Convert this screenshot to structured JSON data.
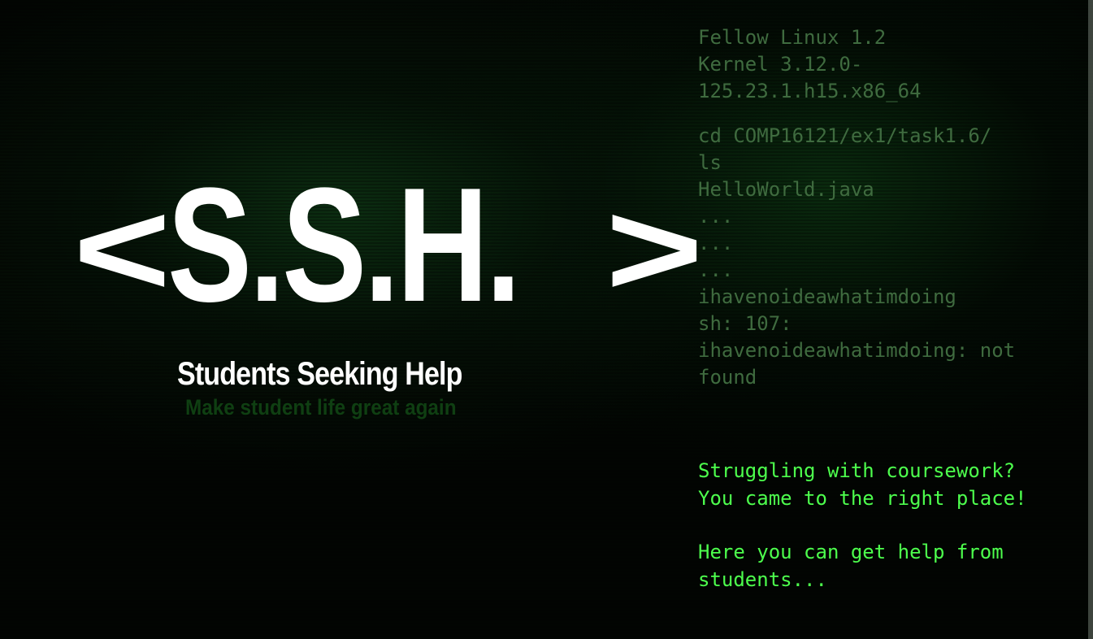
{
  "logo": {
    "left_bracket": "<",
    "text": "S.S.H.",
    "right_bracket": ">"
  },
  "subtitle": "Students Seeking Help",
  "tagline": "Make student life great again",
  "terminal": {
    "lines": [
      "Fellow Linux 1.2",
      "Kernel 3.12.0-",
      "125.23.1.h15.x86_64",
      "",
      "cd COMP16121/ex1/task1.6/",
      "ls",
      "HelloWorld.java",
      "...",
      "...",
      "...",
      "ihavenoideawhatimdoing",
      "sh: 107:",
      "ihavenoideawhatimdoing: not",
      "found"
    ]
  },
  "promo": {
    "line1": "Struggling with coursework?",
    "line2": "You came to the right place!",
    "line3": "Here you can get help from",
    "line4": "students..."
  },
  "colors": {
    "background": "#020502",
    "terminal_text": "#3f6b3f",
    "promo_text": "#4dff4d",
    "tagline_text": "#0f3f12",
    "logo_text": "#ffffff"
  }
}
